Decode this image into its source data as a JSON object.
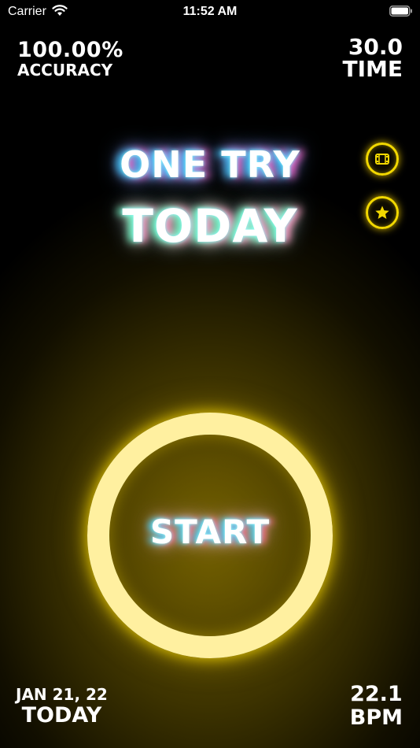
{
  "status_bar": {
    "carrier": "Carrier",
    "time": "11:52 AM"
  },
  "stats": {
    "accuracy": {
      "value": "100.00%",
      "label": "ACCURACY"
    },
    "time": {
      "value": "30.0",
      "label": "TIME"
    },
    "date": {
      "value": "JAN 21, 22",
      "label": "TODAY"
    },
    "bpm": {
      "value": "22.1",
      "label": "BPM"
    }
  },
  "title": {
    "line1": "ONE TRY",
    "line2": "TODAY"
  },
  "side_buttons": {
    "video_icon": "film-icon",
    "rate_icon": "star-icon",
    "accent_color": "#F2D800"
  },
  "start_button": {
    "label": "START",
    "ring_color": "#FFF0A0"
  }
}
